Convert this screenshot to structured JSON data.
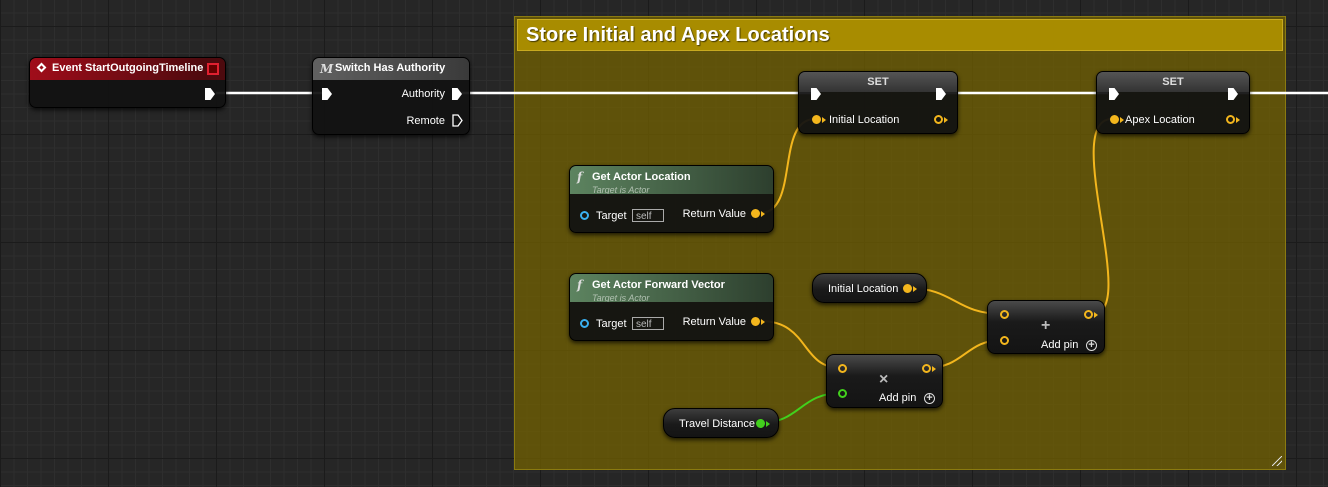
{
  "comment": {
    "title": "Store Initial and Apex Locations"
  },
  "nodes": {
    "event": {
      "title": "Event StartOutgoingTimeline"
    },
    "switch": {
      "title": "Switch Has Authority",
      "icon": "M",
      "out1": "Authority",
      "out2": "Remote"
    },
    "set1": {
      "title": "SET",
      "var": "Initial Location"
    },
    "set2": {
      "title": "SET",
      "var": "Apex Location"
    },
    "get_loc": {
      "icon": "f",
      "title": "Get Actor Location",
      "subtitle": "Target is Actor",
      "target": "Target",
      "self": "self",
      "ret": "Return Value"
    },
    "get_fwd": {
      "icon": "f",
      "title": "Get Actor Forward Vector",
      "subtitle": "Target is Actor",
      "target": "Target",
      "self": "self",
      "ret": "Return Value"
    },
    "init_var": {
      "label": "Initial Location"
    },
    "travel_var": {
      "label": "Travel Distance"
    },
    "add_op": {
      "symbol": "+",
      "add_pin": "Add pin",
      "add_icon": "+"
    },
    "mul_op": {
      "symbol": "×",
      "add_pin": "Add pin",
      "add_icon": "+"
    }
  },
  "colors": {
    "exec": "#ffffff",
    "vector": "#f3b61d",
    "float": "#42d01d",
    "object": "#3ab0f0",
    "comment": "#a88c00"
  }
}
